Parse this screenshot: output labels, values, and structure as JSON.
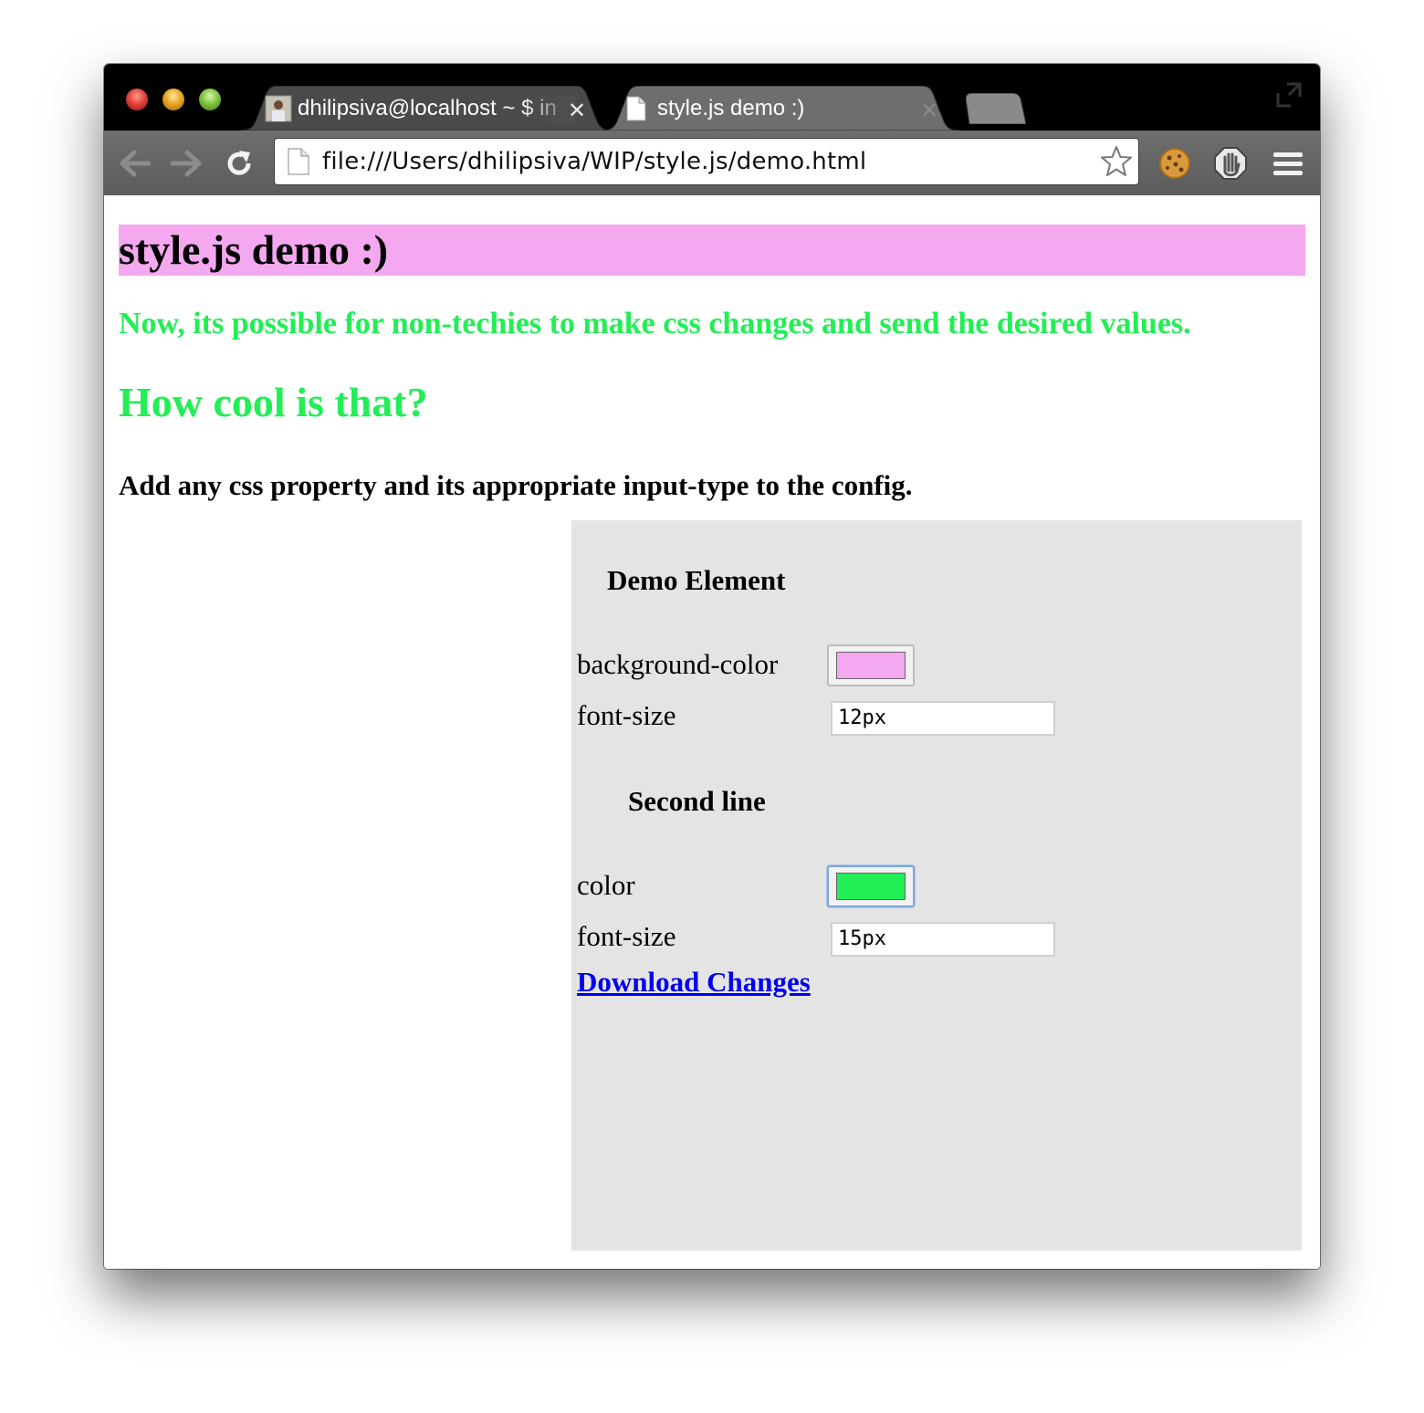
{
  "tabs": [
    {
      "title": "dhilipsiva@localhost ~ $ in",
      "active": false
    },
    {
      "title": "style.js demo :)",
      "active": true
    }
  ],
  "address_bar": {
    "url": "file:///Users/dhilipsiva/WIP/style.js/demo.html"
  },
  "page": {
    "header": "style.js demo :)",
    "line1": "Now, its possible for non-techies to make css changes and send the desired values.",
    "line2": "How cool is that?",
    "line3": "Add any css property and its appropriate input-type to the config."
  },
  "panel": {
    "section1": {
      "title": "Demo Element",
      "prop1_label": "background-color",
      "prop1_color": "#f4a8f0",
      "prop2_label": "font-size",
      "prop2_value": "12px"
    },
    "section2": {
      "title": "Second line",
      "prop1_label": "color",
      "prop1_color": "#22ee55",
      "prop2_label": "font-size",
      "prop2_value": "15px"
    },
    "download_label": "Download Changes"
  },
  "colors": {
    "header_bg": "#f4a8f0",
    "accent_green": "#22ee55",
    "panel_bg": "#e4e4e4",
    "link": "#0000ee"
  },
  "icons": [
    "close-window",
    "minimize-window",
    "zoom-window",
    "tab-favicon-avatar",
    "tab-close-icon",
    "document-icon",
    "back-arrow-icon",
    "forward-arrow-icon",
    "reload-icon",
    "bookmark-star-icon",
    "cookie-extension-icon",
    "adblock-hand-icon",
    "menu-hamburger-icon",
    "fullscreen-icon"
  ]
}
